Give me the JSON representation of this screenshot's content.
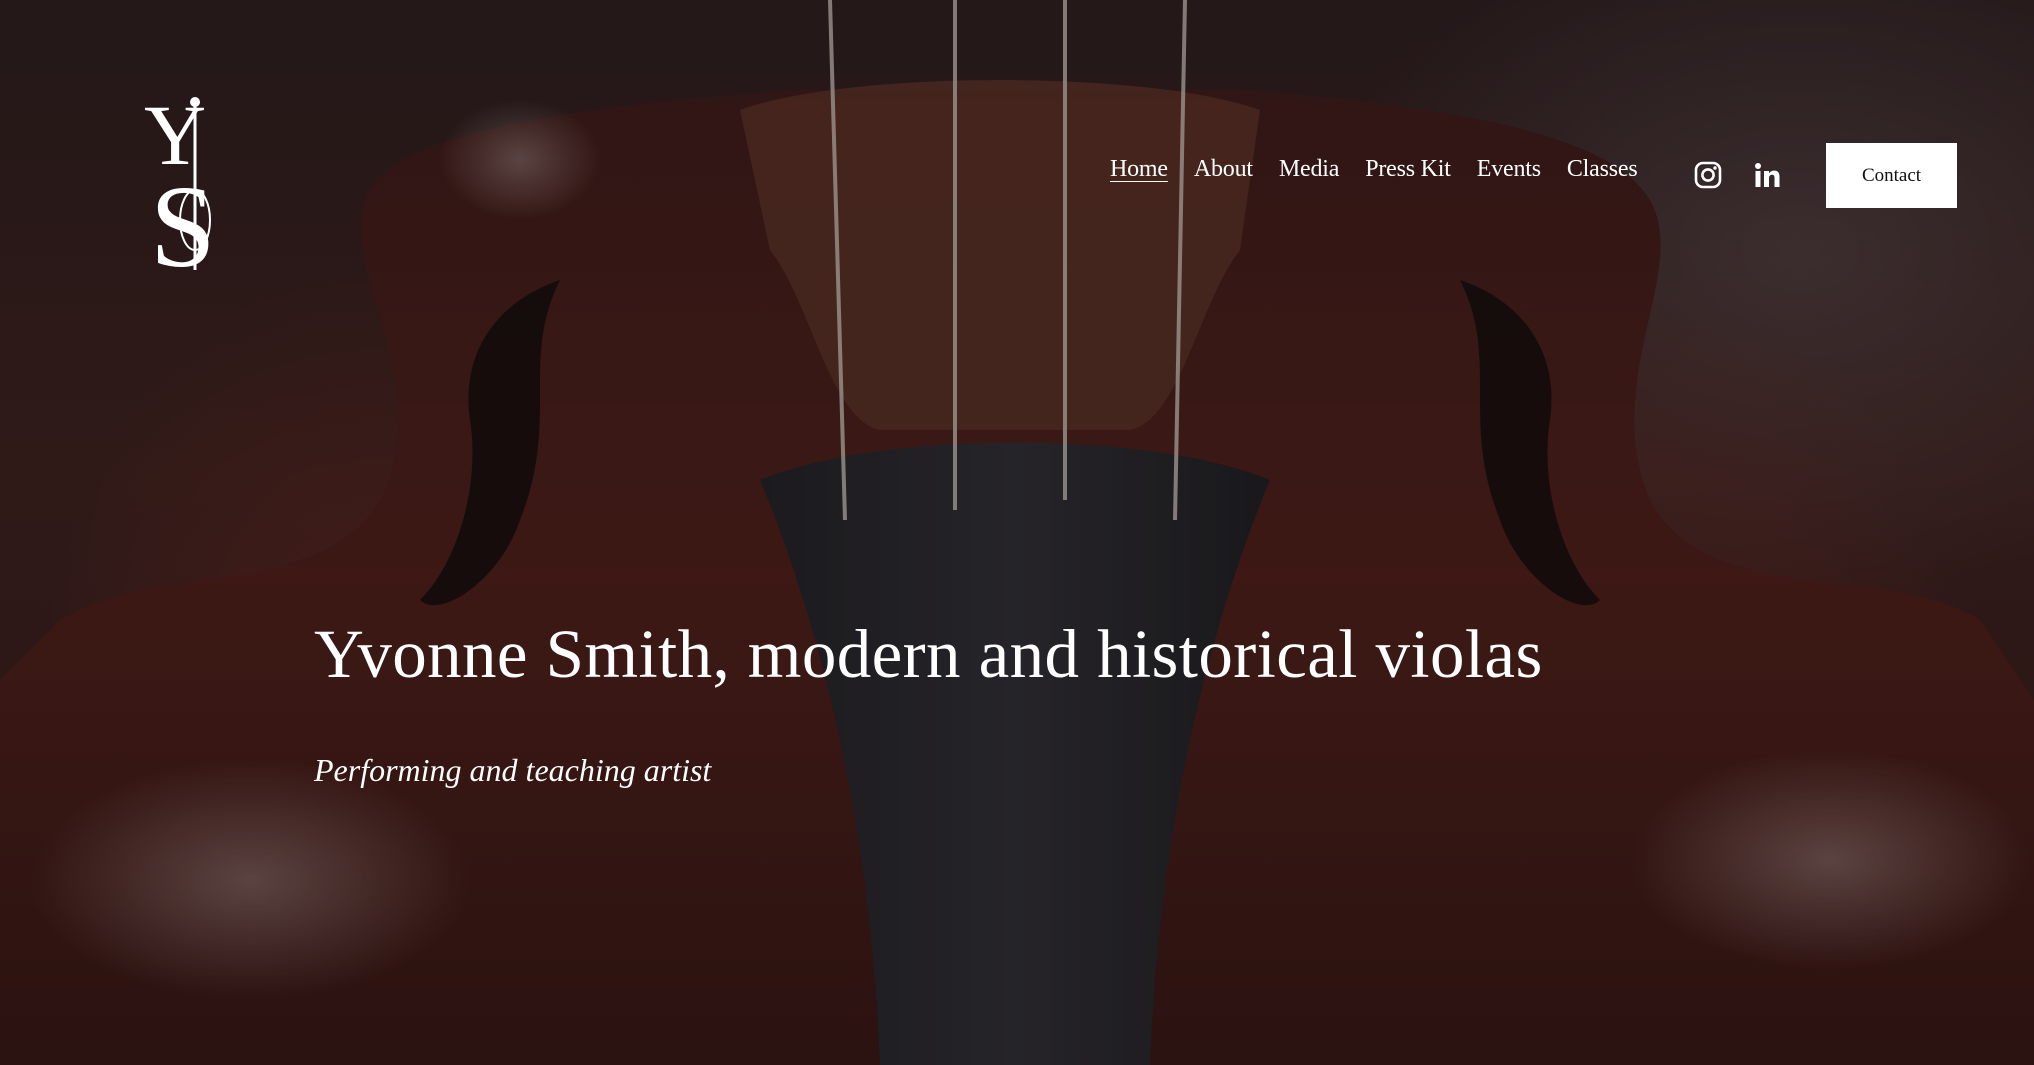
{
  "site": {
    "logo_letters": "YS"
  },
  "nav": {
    "items": [
      {
        "label": "Home",
        "active": true
      },
      {
        "label": "About",
        "active": false
      },
      {
        "label": "Media",
        "active": false
      },
      {
        "label": "Press Kit",
        "active": false
      },
      {
        "label": "Events",
        "active": false
      },
      {
        "label": "Classes",
        "active": false
      }
    ]
  },
  "social": {
    "icons": [
      "instagram-icon",
      "linkedin-icon"
    ]
  },
  "contact": {
    "label": "Contact"
  },
  "hero": {
    "title": "Yvonne Smith, modern and historical violas",
    "subtitle": "Performing and teaching artist",
    "background": "viola-photo"
  },
  "colors": {
    "text": "#ffffff",
    "button_bg": "#ffffff",
    "button_text": "#111111",
    "background_dark": "#2a1c1d",
    "wood": "#5a231d"
  }
}
